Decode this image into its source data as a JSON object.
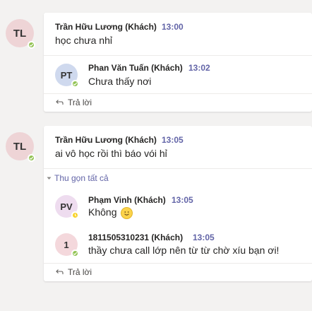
{
  "colors": {
    "accent": "#6264a7",
    "available": "#92c353",
    "away": "#f8d22a",
    "avatar_tl": "#eed4d6",
    "avatar_pt": "#cfd9ee",
    "avatar_pv": "#eedcef",
    "avatar_1": "#f4d8dc"
  },
  "threads": [
    {
      "avatar": {
        "initials": "TL",
        "status": "available"
      },
      "author": "Trần Hữu Lương (Khách)",
      "time": "13:00",
      "text": "học chưa nhỉ",
      "replies": [
        {
          "avatar": {
            "initials": "PT",
            "status": "available"
          },
          "author": "Phan Văn Tuấn (Khách)",
          "time": "13:02",
          "text": "Chưa thấy nơi"
        }
      ],
      "reply_label": "Trả lời"
    },
    {
      "avatar": {
        "initials": "TL",
        "status": "available"
      },
      "author": "Trần Hữu Lương (Khách)",
      "time": "13:05",
      "text": "ai vô học rồi thì báo vói hỉ",
      "collapse_label": "Thu gọn tất cả",
      "replies": [
        {
          "avatar": {
            "initials": "PV",
            "status": "away"
          },
          "author": "Phạm Vinh (Khách)",
          "time": "13:05",
          "text": "Không",
          "emoji": "smile-emoji"
        },
        {
          "avatar": {
            "initials": "1",
            "status": "available"
          },
          "author": "1811505310231 (Khách)",
          "time": "13:05",
          "text": "thầy chưa call lớp nên từ từ chờ xíu bạn ơi!"
        }
      ],
      "reply_label": "Trả lời"
    }
  ]
}
